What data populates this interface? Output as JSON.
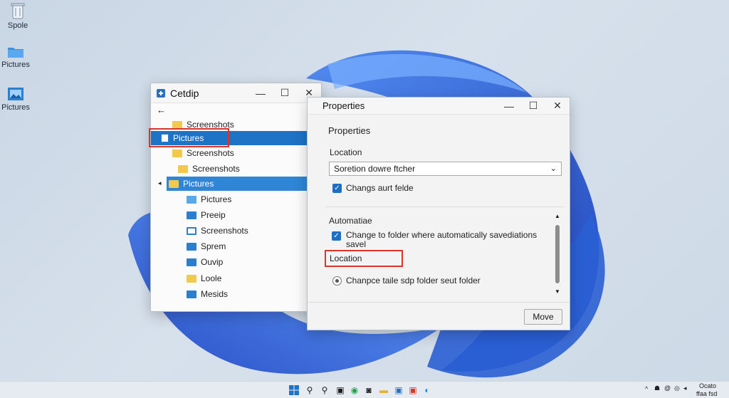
{
  "desktop": {
    "icons": [
      {
        "label": "Spole",
        "icon": "recycle-bin-icon"
      },
      {
        "label": "Pictures",
        "icon": "folder-icon"
      },
      {
        "label": "Pictures",
        "icon": "pictures-folder-icon"
      }
    ]
  },
  "explorer": {
    "title": "Cetdip",
    "back_icon": "back-arrow-icon",
    "tree": [
      {
        "label": "Screenshots",
        "icon": "folder-icon"
      },
      {
        "label": "Pictures",
        "icon": "document-icon",
        "selected": true
      },
      {
        "label": "Screenshots",
        "icon": "folder-icon"
      },
      {
        "label": "Screenshots",
        "icon": "folder-image-icon"
      },
      {
        "label": "Pictures",
        "icon": "pictures-folder-icon",
        "selected": true
      },
      {
        "label": "Pictures",
        "icon": "pictures-icon"
      },
      {
        "label": "Preeip",
        "icon": "folder-icon"
      },
      {
        "label": "Screenshots",
        "icon": "folder-icon"
      },
      {
        "label": "Sprem",
        "icon": "folder-icon"
      },
      {
        "label": "Ouvip",
        "icon": "folder-icon"
      },
      {
        "label": "Loole",
        "icon": "folder-icon"
      },
      {
        "label": "Mesids",
        "icon": "folder-icon"
      }
    ]
  },
  "properties": {
    "title": "Properties",
    "heading": "Properties",
    "location_label": "Location",
    "location_select": "Soretion dowre ftcher",
    "checkbox1_label": "Changs aurt felde",
    "section_label": "Automatiae",
    "checkbox2_label_line1": "Change to folder where automatically savediations",
    "checkbox2_label_line2": "savel",
    "location_label2": "Location",
    "radio_label": "Chanpce taile sdp folder seut folder",
    "move_button": "Move"
  },
  "taskbar": {
    "tray_text_line1": "Ocato",
    "tray_text_line2": "ffaa  fsd"
  },
  "colors": {
    "accent": "#1e73c6",
    "highlight": "#d9352b",
    "wallpaper_blue": "#2a5fd4"
  }
}
